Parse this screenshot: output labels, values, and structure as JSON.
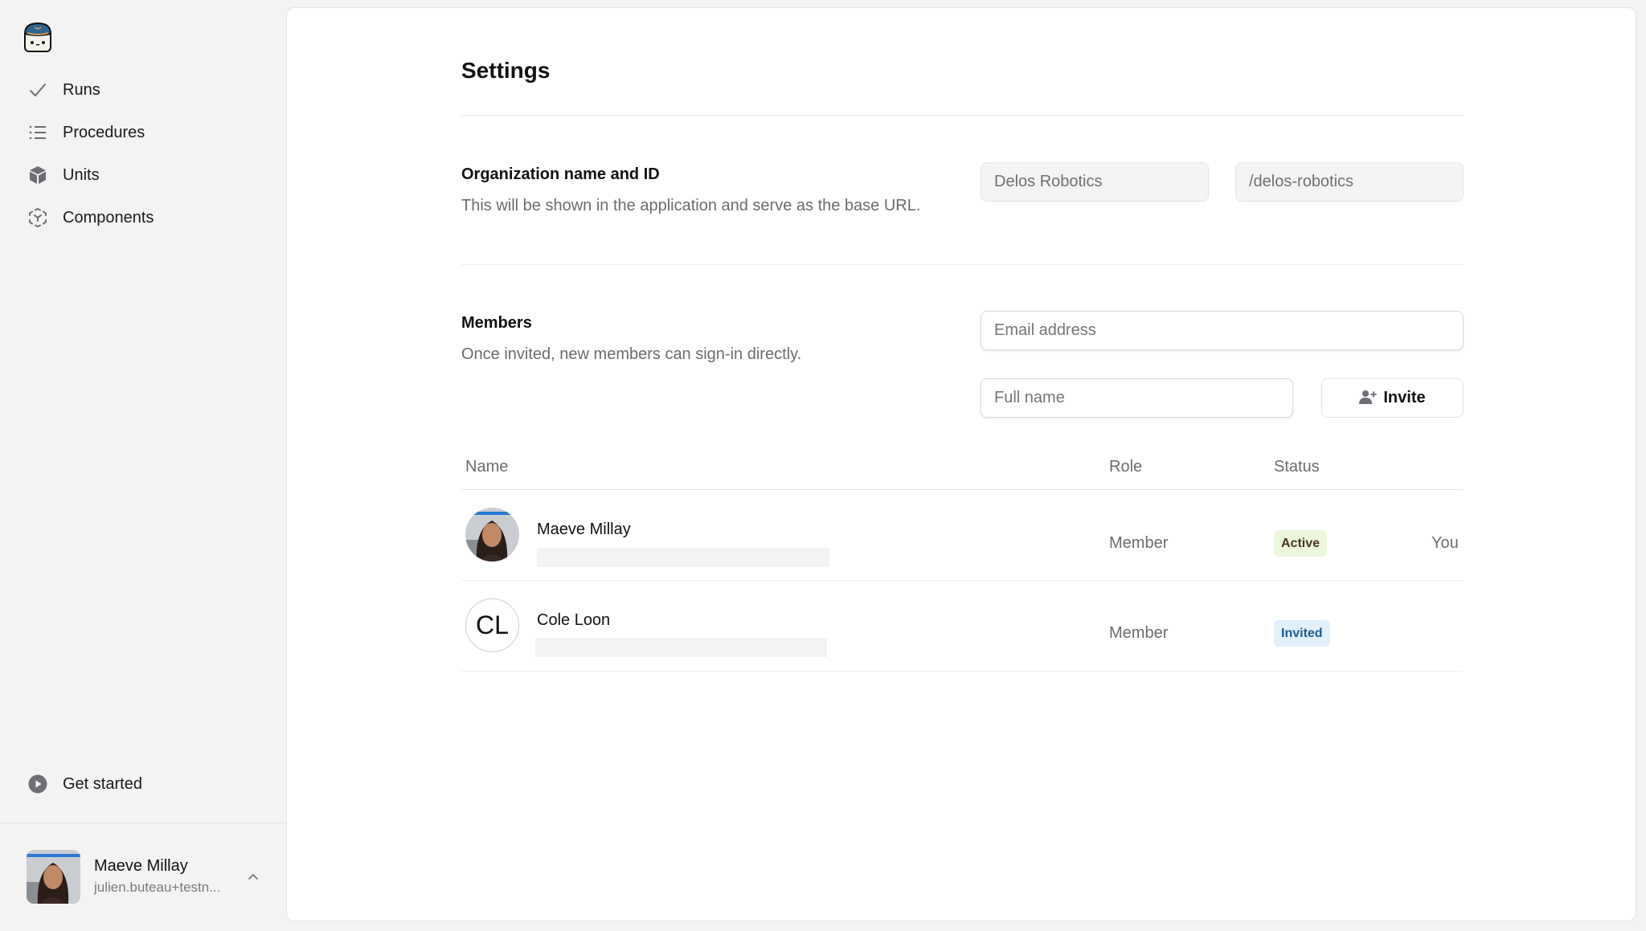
{
  "app": {
    "logo": "mascot-logo"
  },
  "sidebar": {
    "items": [
      {
        "label": "Runs",
        "icon": "check-icon"
      },
      {
        "label": "Procedures",
        "icon": "list-icon"
      },
      {
        "label": "Units",
        "icon": "cube-icon"
      },
      {
        "label": "Components",
        "icon": "component-icon"
      }
    ],
    "get_started": {
      "label": "Get started",
      "icon": "play-circle-icon"
    },
    "user": {
      "name": "Maeve Millay",
      "email": "julien.buteau+testn...",
      "chevron": "chevron-up-icon"
    }
  },
  "main": {
    "title": "Settings",
    "organization": {
      "title": "Organization name and ID",
      "description": "This will be shown in the application and serve as the base URL.",
      "name_value": "Delos Robotics",
      "id_value": "/delos-robotics"
    },
    "members": {
      "title": "Members",
      "description": "Once invited, new members can sign-in directly.",
      "email_placeholder": "Email address",
      "fullname_placeholder": "Full name",
      "invite_label": "Invite",
      "table": {
        "headers": {
          "name": "Name",
          "role": "Role",
          "status": "Status"
        },
        "rows": [
          {
            "name": "Maeve Millay",
            "initials": "",
            "role": "Member",
            "status": "Active",
            "note": "You"
          },
          {
            "name": "Cole Loon",
            "initials": "CL",
            "role": "Member",
            "status": "Invited",
            "note": ""
          }
        ]
      }
    }
  },
  "colors": {
    "sidebar_bg": "#f3f3f3",
    "panel_bg": "#ffffff",
    "active_badge_bg": "#ecf7dc",
    "active_badge_text": "#4a3520",
    "invited_badge_bg": "#e1f0fb",
    "invited_badge_text": "#1c5c8e"
  }
}
